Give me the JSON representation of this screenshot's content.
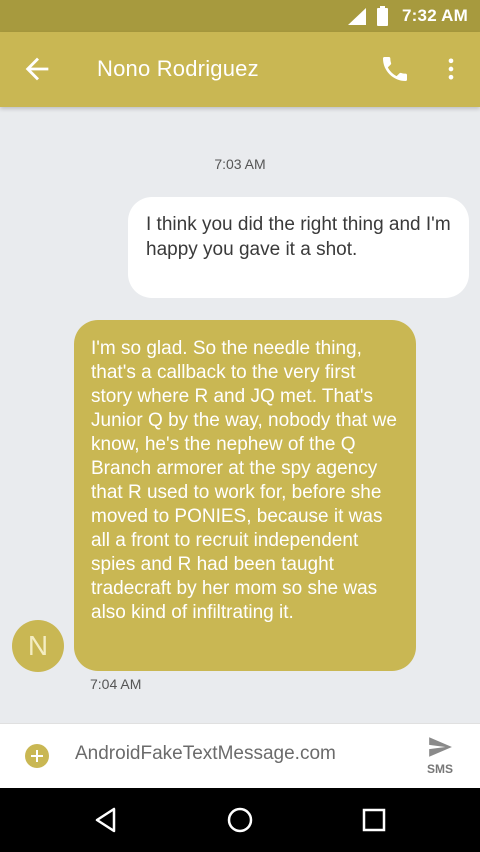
{
  "status_bar": {
    "time": "7:32 AM"
  },
  "header": {
    "contact_name": "Nono Rodriguez"
  },
  "conversation": {
    "timestamp_top": "7:03 AM",
    "outgoing_message": "I think you did the right thing and I'm happy you gave it a shot.",
    "incoming_message": "I'm so glad. So the needle thing, that's a callback to the very first story where R and JQ met. That's Junior Q by the way, nobody that we know, he's the nephew of the Q Branch armorer at the spy agency that R used to work for, before she moved to PONIES, because it was all a front to recruit independent spies and R had been taught tradecraft by her mom so she was also kind of infiltrating it.",
    "incoming_timestamp": "7:04 AM",
    "avatar_initial": "N"
  },
  "composer": {
    "text": "AndroidFakeTextMessage.com",
    "send_label": "SMS"
  },
  "colors": {
    "accent": "#c9b753",
    "status_bar": "#a79a3e",
    "background": "#e9ebee"
  }
}
